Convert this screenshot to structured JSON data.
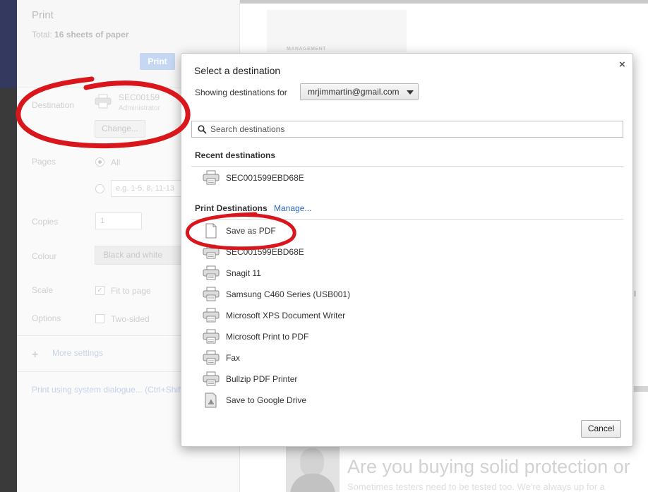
{
  "print_panel": {
    "title": "Print",
    "total_label": "Total:",
    "total_value": "16 sheets of paper",
    "print_button": "Print",
    "destination_label": "Destination",
    "destination_name": "SEC00159",
    "destination_sub": "Administrator",
    "change_button": "Change...",
    "pages_label": "Pages",
    "pages_all": "All",
    "pages_placeholder": "e.g. 1-5, 8, 11-13",
    "copies_label": "Copies",
    "copies_value": "1",
    "colour_label": "Colour",
    "colour_value": "Black and white",
    "scale_label": "Scale",
    "scale_option": "Fit to page",
    "options_label": "Options",
    "options_option": "Two-sided",
    "more_settings": "More settings",
    "system_dialogue": "Print using system dialogue... (Ctrl+Shift"
  },
  "preview": {
    "management": "MANAGEMENT",
    "headline": "Are you buying solid protection or",
    "subline": "Sometimes testers need to be tested too. We're always up for a"
  },
  "dialog": {
    "title": "Select a destination",
    "close_glyph": "×",
    "showing_label": "Showing destinations for",
    "account": "mrjimmartin@gmail.com",
    "search_placeholder": "Search destinations",
    "recent_heading": "Recent destinations",
    "recent": [
      {
        "label": "SEC001599EBD68E",
        "icon": "printer"
      }
    ],
    "print_heading": "Print Destinations",
    "manage_link": "Manage...",
    "destinations": [
      {
        "label": "Save as PDF",
        "icon": "document"
      },
      {
        "label": "SEC001599EBD68E",
        "icon": "printer"
      },
      {
        "label": "Snagit 11",
        "icon": "printer"
      },
      {
        "label": "Samsung C460 Series (USB001)",
        "icon": "printer"
      },
      {
        "label": "Microsoft XPS Document Writer",
        "icon": "printer"
      },
      {
        "label": "Microsoft Print to PDF",
        "icon": "printer"
      },
      {
        "label": "Fax",
        "icon": "printer"
      },
      {
        "label": "Bullzip PDF Printer",
        "icon": "printer"
      },
      {
        "label": "Save to Google Drive",
        "icon": "drive"
      }
    ],
    "cancel_button": "Cancel"
  },
  "colors": {
    "annotation_red": "#d9161c",
    "link_blue": "#2a66c8",
    "print_button_blue": "#c5d7f3"
  }
}
